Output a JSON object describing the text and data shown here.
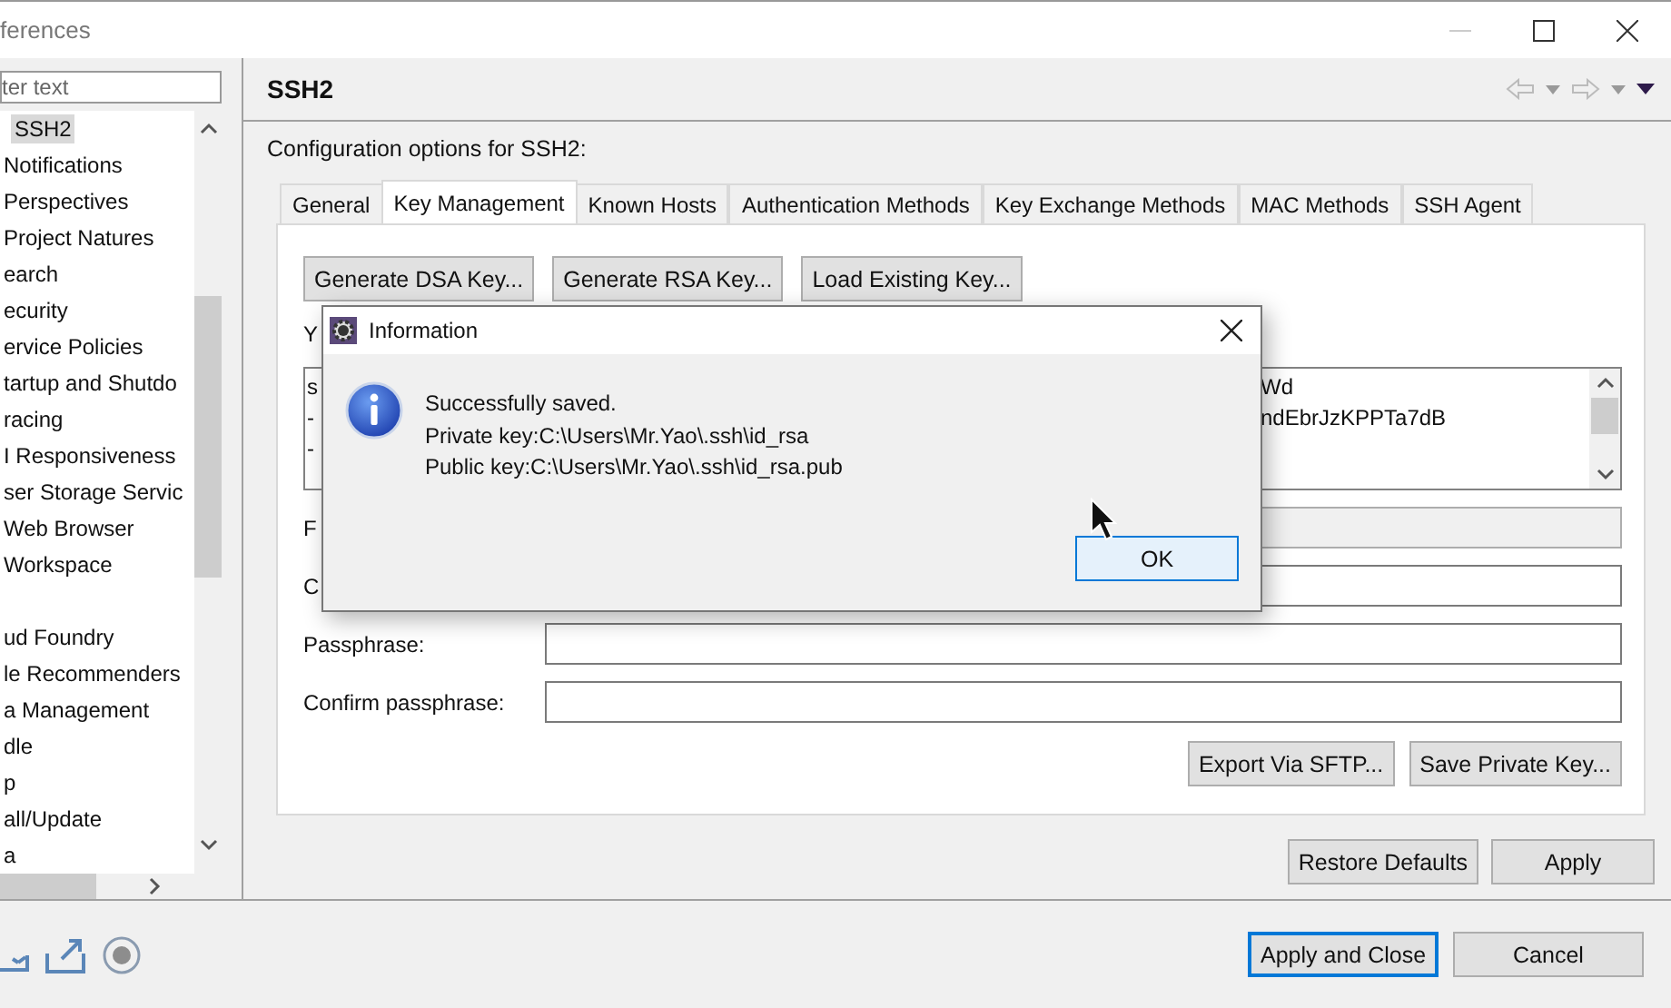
{
  "window": {
    "title": "ferences"
  },
  "filter": {
    "placeholder": "ter text"
  },
  "tree": [
    {
      "label": "SSH2",
      "selected": true
    },
    {
      "label": "Notifications",
      "selected": false
    },
    {
      "label": "Perspectives",
      "selected": false
    },
    {
      "label": "Project Natures",
      "selected": false
    },
    {
      "label": "earch",
      "selected": false
    },
    {
      "label": "ecurity",
      "selected": false
    },
    {
      "label": "ervice Policies",
      "selected": false
    },
    {
      "label": "tartup and Shutdo",
      "selected": false
    },
    {
      "label": "racing",
      "selected": false
    },
    {
      "label": "I Responsiveness",
      "selected": false
    },
    {
      "label": "ser Storage Servic",
      "selected": false
    },
    {
      "label": "Web Browser",
      "selected": false
    },
    {
      "label": "Workspace",
      "selected": false
    },
    {
      "label": "ud Foundry",
      "selected": false,
      "gap_before": true
    },
    {
      "label": "le Recommenders",
      "selected": false
    },
    {
      "label": "a Management",
      "selected": false
    },
    {
      "label": "dle",
      "selected": false
    },
    {
      "label": "p",
      "selected": false
    },
    {
      "label": "all/Update",
      "selected": false
    },
    {
      "label": "a",
      "selected": false
    }
  ],
  "page": {
    "title": "SSH2",
    "description": "Configuration options for SSH2:"
  },
  "tabs": [
    {
      "label": "General",
      "selected": false
    },
    {
      "label": "Key Management",
      "selected": true
    },
    {
      "label": "Known Hosts",
      "selected": false
    },
    {
      "label": "Authentication Methods",
      "selected": false
    },
    {
      "label": "Key Exchange Methods",
      "selected": false
    },
    {
      "label": "MAC Methods",
      "selected": false
    },
    {
      "label": "SSH Agent",
      "selected": false
    }
  ],
  "key_buttons": [
    "Generate DSA Key...",
    "Generate RSA Key...",
    "Load Existing Key..."
  ],
  "key_label": "Y",
  "key_text_lines": [
    {
      "left": "s",
      "right": "Wd"
    },
    {
      "left": "-",
      "right": "ndEbrJzKPPTa7dB"
    },
    {
      "left": "-"
    }
  ],
  "fields": [
    {
      "label": "F",
      "disabled": true
    },
    {
      "label": "C",
      "disabled": false
    },
    {
      "label": "Passphrase:",
      "disabled": false
    },
    {
      "label": "Confirm passphrase:",
      "disabled": false
    }
  ],
  "key_actions": [
    "Export Via SFTP...",
    "Save Private Key..."
  ],
  "page_buttons": [
    "Restore Defaults",
    "Apply"
  ],
  "footer_buttons": [
    {
      "label": "Apply and Close",
      "default": true
    },
    {
      "label": "Cancel",
      "default": false
    }
  ],
  "dialog": {
    "title": "Information",
    "message": "Successfully saved.\nPrivate key:C:\\Users\\Mr.Yao\\.ssh\\id_rsa\nPublic key:C:\\Users\\Mr.Yao\\.ssh\\id_rsa.pub",
    "button": "OK"
  }
}
